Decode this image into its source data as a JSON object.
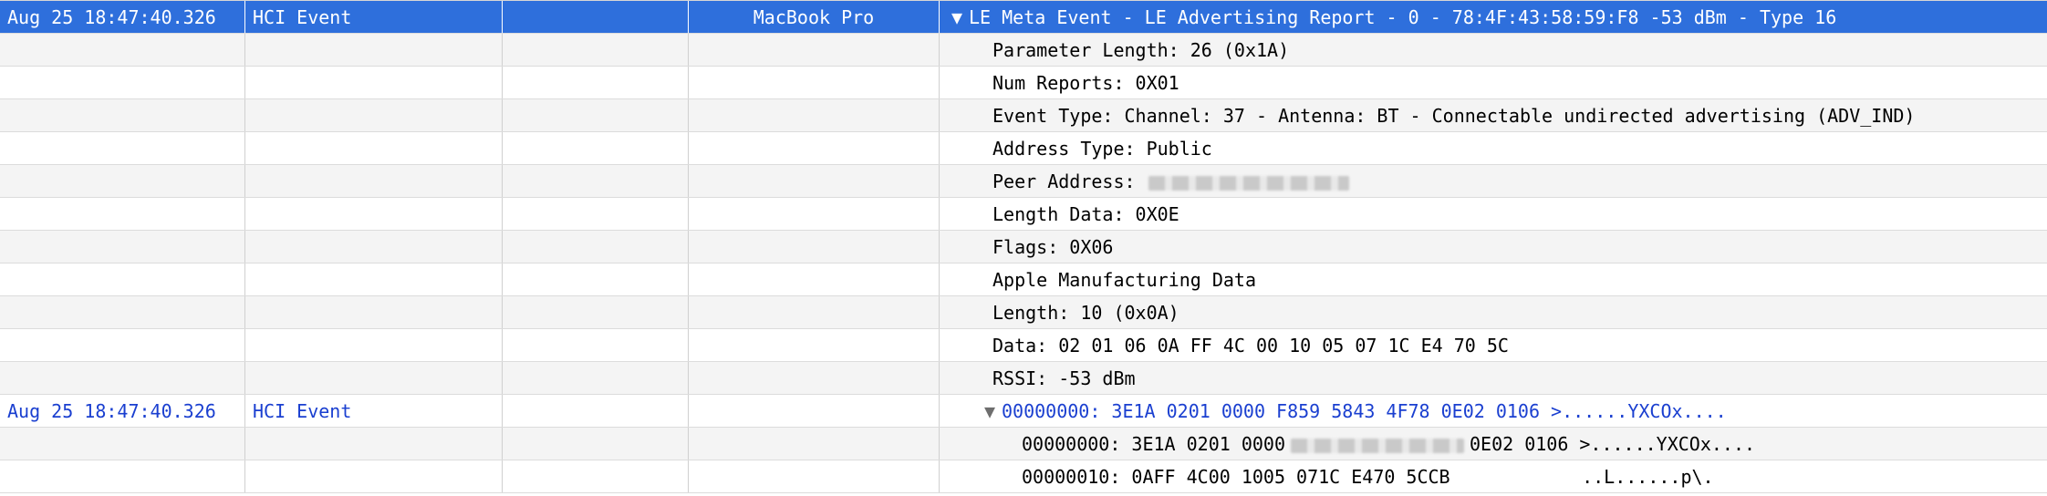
{
  "rows": [
    {
      "time": "Aug 25 18:47:40.326",
      "type": "HCI Event",
      "device": "MacBook Pro",
      "detail": "LE Meta Event - LE Advertising Report - 0 - 78:4F:43:58:59:F8  -53 dBm - Type 16"
    },
    {
      "detail": "Parameter Length: 26 (0x1A)"
    },
    {
      "detail": "Num Reports: 0X01"
    },
    {
      "detail": "Event Type: Channel: 37 - Antenna: BT - Connectable undirected advertising (ADV_IND)"
    },
    {
      "detail": "Address Type: Public"
    },
    {
      "detail": "Peer Address:"
    },
    {
      "detail": "Length Data: 0X0E"
    },
    {
      "detail": "Flags: 0X06"
    },
    {
      "detail": "Apple Manufacturing Data"
    },
    {
      "detail": "Length: 10 (0x0A)"
    },
    {
      "detail": "Data: 02 01 06 0A FF 4C 00 10 05 07 1C E4 70 5C"
    },
    {
      "detail": "RSSI: -53 dBm"
    },
    {
      "time": "Aug 25 18:47:40.326",
      "type": "HCI Event",
      "device": "",
      "detail": "00000000: 3E1A 0201 0000 F859 5843 4F78 0E02 0106  >......YXCOx...."
    },
    {
      "detail_a": "00000000: 3E1A 0201 0000",
      "detail_b": "0E02 0106  >......YXCOx...."
    },
    {
      "detail": "00000010: 0AFF 4C00 1005 071C E470 5CCB            ..L......p\\."
    }
  ],
  "icons": {
    "expanded": "disclosure-triangle-down-icon"
  },
  "colors": {
    "selection": "#2e6fdc",
    "link_text": "#1a3fd0"
  }
}
